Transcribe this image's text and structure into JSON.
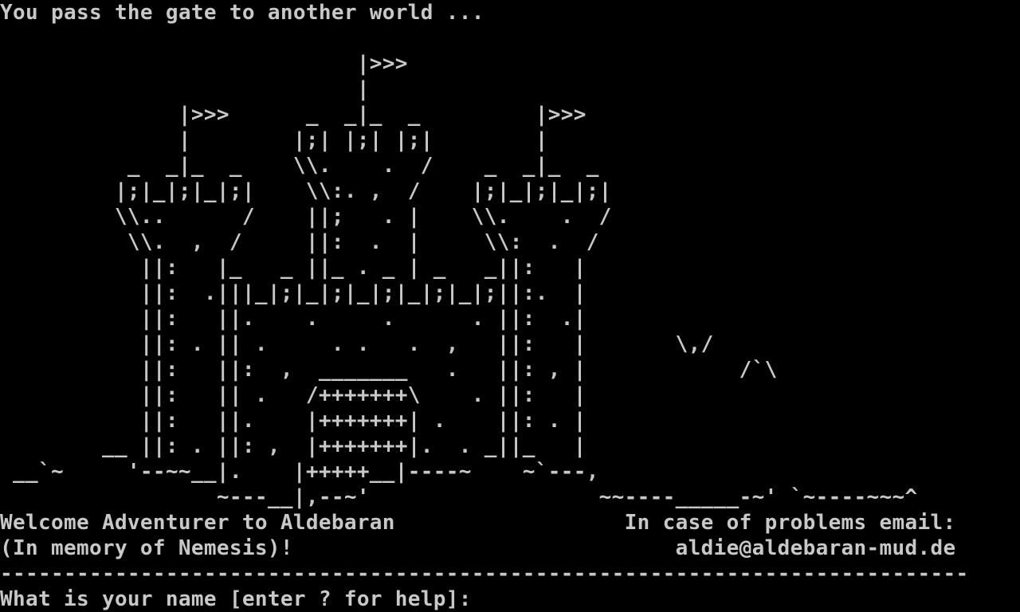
{
  "terminal": {
    "colors": {
      "background": "#000000",
      "text": "#c8c8c8"
    },
    "lines": [
      "You pass the gate to another world ...",
      "",
      "                            |>>>",
      "                            |",
      "              |>>>      _  _|_  _         |>>>",
      "              |        |;| |;| |;|        |",
      "          _  _|_  _    \\\\.    .  /    _  _|_  _",
      "         |;|_|;|_|;|    \\\\:. ,  /    |;|_|;|_|;|",
      "         \\\\..      /    ||;   . |    \\\\.    .  /",
      "          \\\\.  ,  /     ||:  .  |     \\\\:  .  /",
      "           ||:   |_   _ ||_ . _ | _   _||:   |",
      "           ||:  .|||_|;|_|;|_|;|_|;|_|;||:.  |",
      "           ||:   ||.    .     .      . ||:  .|",
      "           ||: . || .     . .   .  ,   ||:   |       \\,/",
      "           ||:   ||:  ,  _______   .   ||: , |            /`\\",
      "           ||:   || .   /+++++++\\    . ||:   |",
      "           ||:   ||.    |+++++++| .    ||: . |",
      "        __ ||: . ||: ,  |+++++++|.  . _||_   |",
      " __`~     '--~~__|.    |+++++__|----~    ~`---,",
      "                 ~---__|,--~'                  ~~----_____-~' `~----~~~^",
      "Welcome Adventurer to Aldebaran                  In case of problems email:",
      "(In memory of Nemesis)!                              aldie@aldebaran-mud.de",
      "----------------------------------------------------------------------------",
      "What is your name [enter ? for help]:"
    ]
  }
}
